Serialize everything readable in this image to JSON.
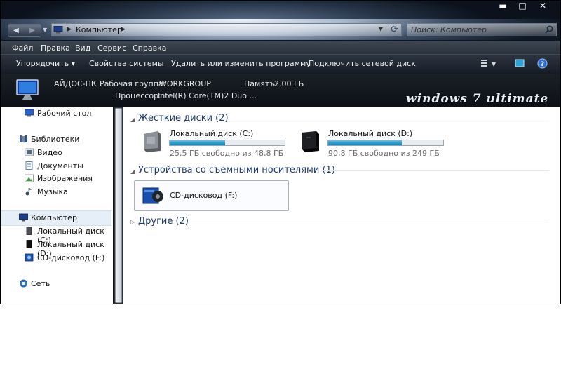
{
  "title_buttons": {
    "minimize": "▬",
    "maximize": "□",
    "close": "✕"
  },
  "address": {
    "breadcrumb": "Компьютер",
    "search_placeholder": "Поиск: Компьютер"
  },
  "menu": [
    "Файл",
    "Правка",
    "Вид",
    "Сервис",
    "Справка"
  ],
  "toolbar": {
    "items": [
      "Упорядочить",
      "Свойства системы",
      "Удалить или изменить программу",
      "Подключить сетевой диск"
    ],
    "organize_arrow": "▾"
  },
  "details": {
    "computer_name": "АЙДОС-ПК",
    "workgroup_label": "Рабочая группа:",
    "workgroup": "WORKGROUP",
    "memory_label": "Памятъ:",
    "memory": "2,00 ГБ",
    "processor_label": "Процессор:",
    "processor": "Intel(R) Core(TM)2 Duo ...",
    "brand": "windows 7 ultimate"
  },
  "sidebar": {
    "desktop": "Рабочий стол",
    "libraries": "Библиотеки",
    "library_items": [
      "Видео",
      "Документы",
      "Изображения",
      "Музыка"
    ],
    "computer": "Компьютер",
    "computer_items": [
      "Локальный диск (C:)",
      "Локальный диск (D:)",
      "CD-дисковод (F:)"
    ],
    "network": "Сеть"
  },
  "groups": {
    "hard_disks": "Жесткие диски (2)",
    "removable": "Устройства со съемными носителями (1)",
    "other": "Другие (2)"
  },
  "drives": [
    {
      "name": "Локальный диск (C:)",
      "free": "25,5 ГБ свободно из 48,8 ГБ",
      "used_fraction": 0.48
    },
    {
      "name": "Локальный диск (D:)",
      "free": "90,8 ГБ свободно из 249 ГБ",
      "used_fraction": 0.64
    }
  ],
  "cd": {
    "name": "CD-дисковод (F:)"
  },
  "colors": {
    "accent": "#1e3a6e",
    "bar": "#2698cc",
    "selection": "#e6eef8"
  }
}
